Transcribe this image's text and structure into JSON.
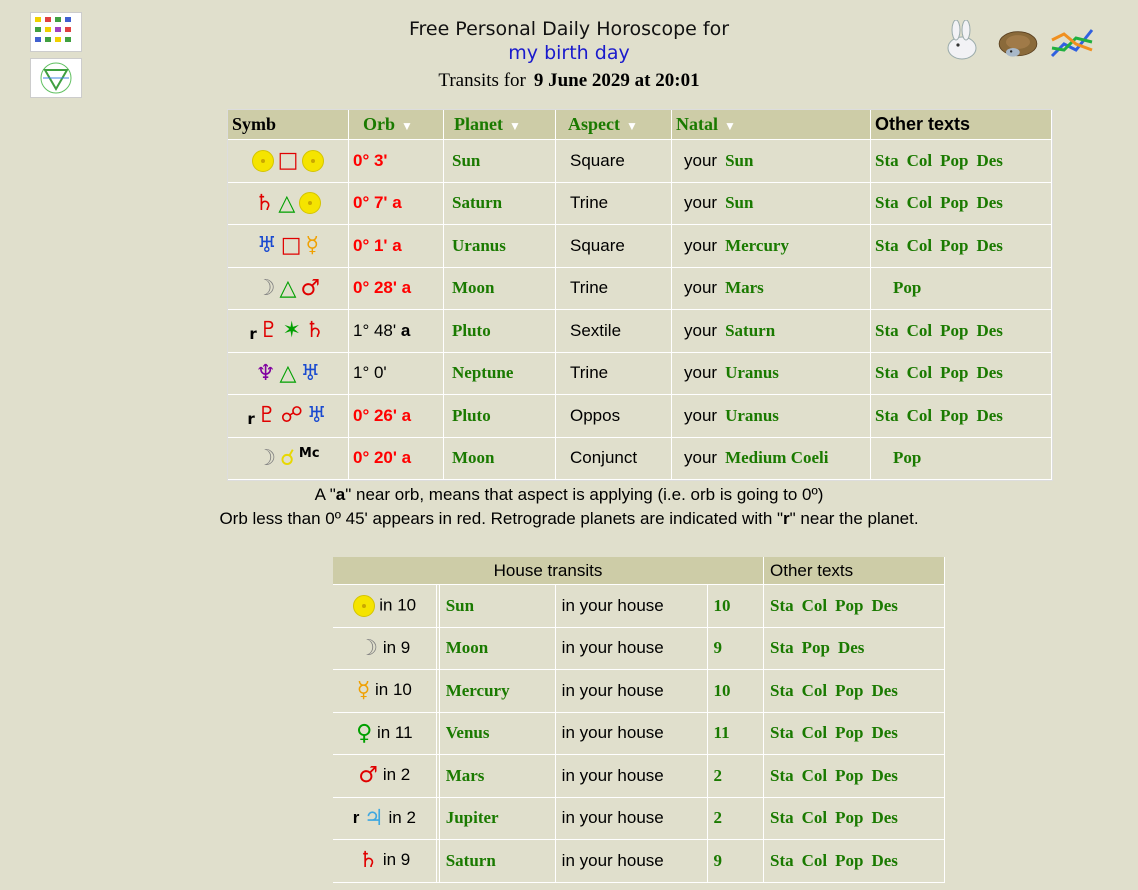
{
  "header": {
    "line1": "Free Personal Daily Horoscope for",
    "line2": "my birth day",
    "transits_prefix": "Transits for",
    "transits_date": "9 June 2029 at 20:01"
  },
  "transits_table": {
    "headers": {
      "symb": "Symb",
      "orb": "Orb",
      "planet": "Planet",
      "aspect": "Aspect",
      "natal": "Natal",
      "other": "Other texts"
    },
    "your": "your",
    "rows": [
      {
        "retro": "",
        "g1": "☉",
        "g1c": "#e8d800",
        "asp": "□",
        "aspc": "#e00000",
        "g2": "☉",
        "g2c": "#e8d800",
        "orb": "0° 3'",
        "red": true,
        "planet": "Sun",
        "aspect": "Square",
        "natal": "Sun",
        "links": [
          "Sta",
          "Col",
          "Pop",
          "Des"
        ]
      },
      {
        "retro": "",
        "g1": "♄",
        "g1c": "#e00000",
        "asp": "△",
        "aspc": "#00a000",
        "g2": "☉",
        "g2c": "#e8d800",
        "orb": "0° 7' a",
        "red": true,
        "planet": "Saturn",
        "aspect": "Trine",
        "natal": "Sun",
        "links": [
          "Sta",
          "Col",
          "Pop",
          "Des"
        ]
      },
      {
        "retro": "",
        "g1": "♅",
        "g1c": "#1a4ad0",
        "asp": "□",
        "aspc": "#e00000",
        "g2": "☿",
        "g2c": "#f0a000",
        "orb": "0° 1' a",
        "red": true,
        "planet": "Uranus",
        "aspect": "Square",
        "natal": "Mercury",
        "links": [
          "Sta",
          "Col",
          "Pop",
          "Des"
        ]
      },
      {
        "retro": "",
        "g1": "☽",
        "g1c": "#808080",
        "asp": "△",
        "aspc": "#00a000",
        "g2": "♂",
        "g2c": "#e00000",
        "orb": "0° 28' a",
        "red": true,
        "planet": "Moon",
        "aspect": "Trine",
        "natal": "Mars",
        "links": [
          "Pop"
        ]
      },
      {
        "retro": "r",
        "g1": "♇",
        "g1c": "#e00000",
        "asp": "✶",
        "aspc": "#00a000",
        "g2": "♄",
        "g2c": "#e00000",
        "orb": "1° 48'",
        "orb_suffix": "a",
        "red": false,
        "planet": "Pluto",
        "aspect": "Sextile",
        "natal": "Saturn",
        "links": [
          "Sta",
          "Col",
          "Pop",
          "Des"
        ]
      },
      {
        "retro": "",
        "g1": "♆",
        "g1c": "#8000a0",
        "asp": "△",
        "aspc": "#00a000",
        "g2": "♅",
        "g2c": "#1a4ad0",
        "orb": "1° 0'",
        "orb_suffix": "",
        "red": false,
        "planet": "Neptune",
        "aspect": "Trine",
        "natal": "Uranus",
        "links": [
          "Sta",
          "Col",
          "Pop",
          "Des"
        ]
      },
      {
        "retro": "r",
        "g1": "♇",
        "g1c": "#e00000",
        "asp": "☍",
        "aspc": "#e00000",
        "g2": "♅",
        "g2c": "#1a4ad0",
        "orb": "0° 26' a",
        "red": true,
        "planet": "Pluto",
        "aspect": "Oppos",
        "natal": "Uranus",
        "links": [
          "Sta",
          "Col",
          "Pop",
          "Des"
        ]
      },
      {
        "retro": "",
        "g1": "☽",
        "g1c": "#808080",
        "asp": "☌",
        "aspc": "#e8d800",
        "g2": "Mc",
        "g2c": "#000000",
        "orb": "0° 20' a",
        "red": true,
        "planet": "Moon",
        "aspect": "Conjunct",
        "natal": "Medium Coeli",
        "links": [
          "Pop"
        ]
      }
    ]
  },
  "notes": {
    "line1_a": "A \"",
    "line1_b": "a",
    "line1_c": "\" near orb, means that aspect is applying (i.e. orb is going to 0º)",
    "line2_a": "Orb less than 0º 45' appears in red. Retrograde planets are indicated with \"",
    "line2_b": "r",
    "line2_c": "\" near the planet."
  },
  "house_table": {
    "headers": {
      "house": "House transits",
      "other": "Other texts"
    },
    "in_prefix": "in",
    "in_your_house": "in your house",
    "rows": [
      {
        "retro": "",
        "glyph": "sun",
        "gc": "#e8d800",
        "house": "10",
        "planet": "Sun",
        "links": [
          "Sta",
          "Col",
          "Pop",
          "Des"
        ]
      },
      {
        "retro": "",
        "glyph": "☽",
        "gc": "#808080",
        "house": "9",
        "planet": "Moon",
        "links": [
          "Sta",
          "Pop",
          "Des"
        ]
      },
      {
        "retro": "",
        "glyph": "☿",
        "gc": "#f0a000",
        "house": "10",
        "planet": "Mercury",
        "links": [
          "Sta",
          "Col",
          "Pop",
          "Des"
        ]
      },
      {
        "retro": "",
        "glyph": "♀",
        "gc": "#00a000",
        "house": "11",
        "planet": "Venus",
        "links": [
          "Sta",
          "Col",
          "Pop",
          "Des"
        ]
      },
      {
        "retro": "",
        "glyph": "♂",
        "gc": "#e00000",
        "house": "2",
        "planet": "Mars",
        "links": [
          "Sta",
          "Col",
          "Pop",
          "Des"
        ]
      },
      {
        "retro": "r",
        "glyph": "♃",
        "gc": "#40a8e0",
        "house": "2",
        "planet": "Jupiter",
        "links": [
          "Sta",
          "Col",
          "Pop",
          "Des"
        ]
      },
      {
        "retro": "",
        "glyph": "♄",
        "gc": "#e00000",
        "house": "9",
        "planet": "Saturn",
        "links": [
          "Sta",
          "Col",
          "Pop",
          "Des"
        ]
      }
    ]
  },
  "icons": [
    "chart-grid-thumbnail-icon",
    "chart-wheel-thumbnail-icon",
    "rabbit-icon",
    "turtle-icon",
    "line-chart-icon"
  ]
}
